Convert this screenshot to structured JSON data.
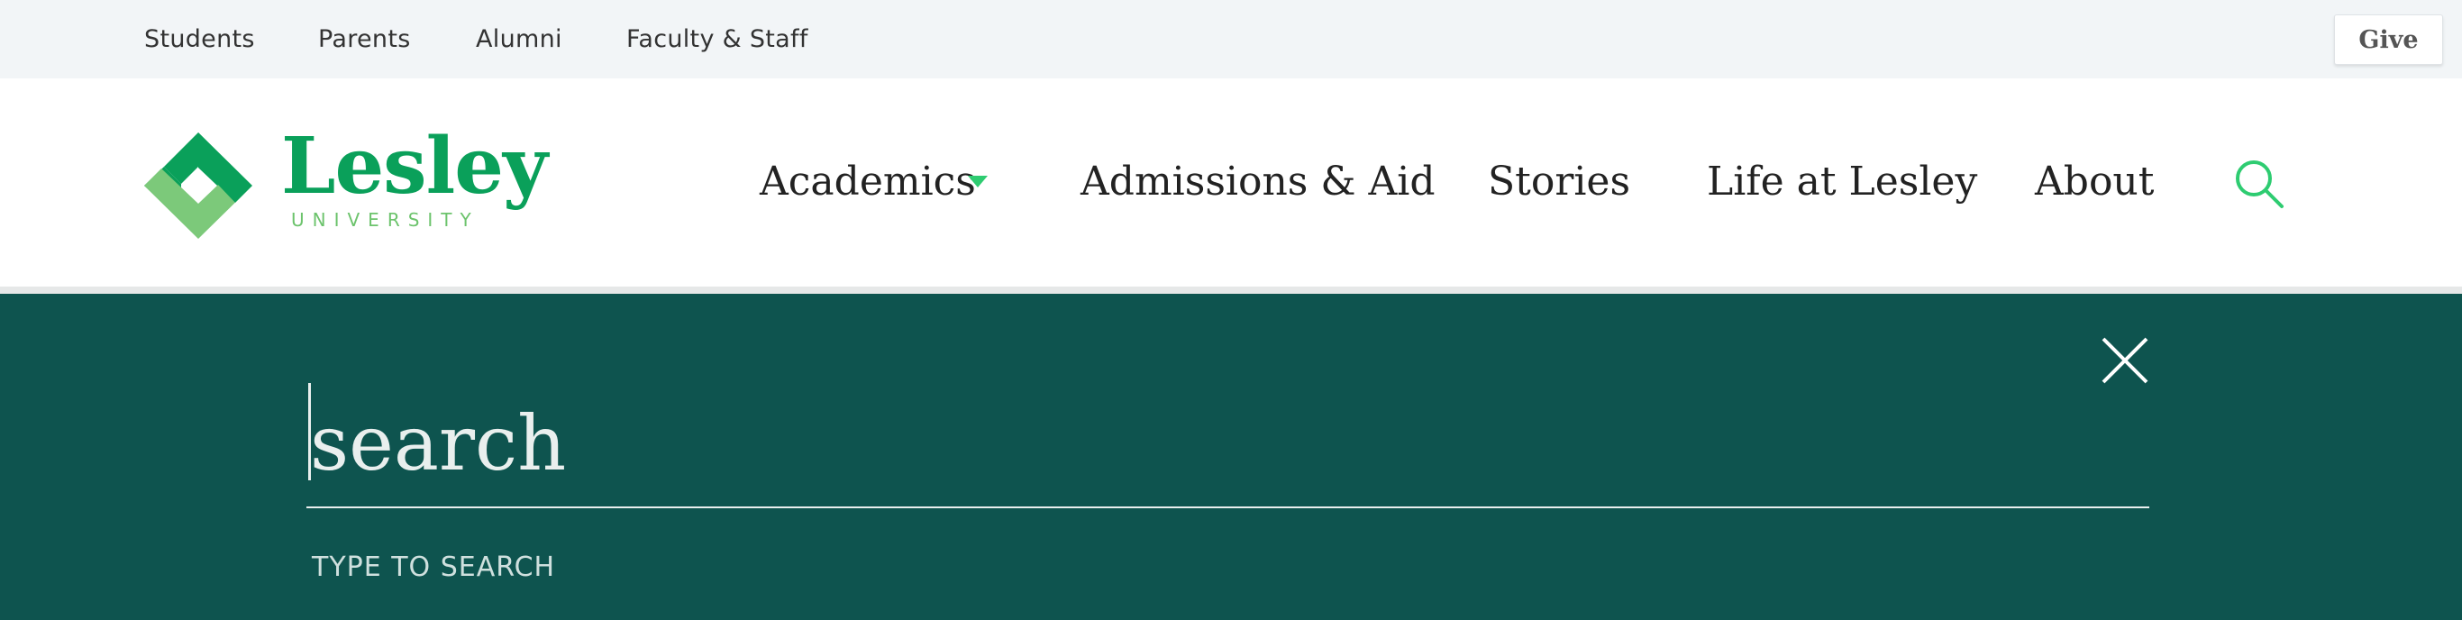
{
  "utility_nav": {
    "links": [
      "Students",
      "Parents",
      "Alumni",
      "Faculty & Staff"
    ],
    "give_label": "Give"
  },
  "logo": {
    "wordmark": "Lesley",
    "subline": "UNIVERSITY",
    "icon": "lesley-diamond-logo-icon",
    "colors": {
      "green": "#0aa05a",
      "light_green": "#6cc36c"
    }
  },
  "main_nav": {
    "items": [
      "Academics",
      "Admissions & Aid",
      "Stories",
      "Life at Lesley",
      "About"
    ],
    "academics_has_dropdown": true,
    "search_icon": "search-icon"
  },
  "search_overlay": {
    "placeholder": "search",
    "value": "",
    "hint": "TYPE TO SEARCH",
    "close_icon": "close-icon",
    "background": "#0e544f"
  }
}
